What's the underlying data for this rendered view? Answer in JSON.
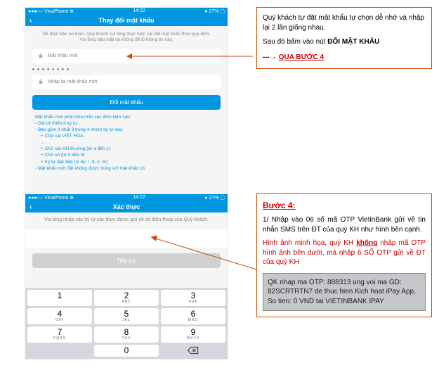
{
  "phone1": {
    "status": {
      "carrier": "●●●○○ VinaPhone ⊕",
      "time": "14:22",
      "battery": "● 27% ▢"
    },
    "title": "Thay đổi mật khẩu",
    "subtitle": "Để đảm bảo an toàn, Quý khách vui lòng thực hiện cài đặt mật khẩu theo quy định. Vui lòng bảo mật và không để lộ thông tin này.",
    "input1_label": "Mật khẩu mới",
    "input1_dots": "• • • • • • • •",
    "input2_label": "Nhập lại mật khẩu mới",
    "button": "Đổi mật khẩu",
    "rules": {
      "header": "Mật khẩu mới phải thỏa mãn các điều kiện sau:",
      "r1": "- Dài tối thiểu 8 ký tự",
      "r2": "- Bao gồm ít nhất 3 trong 4 nhóm ký tự sau:",
      "r2a": "+ Chữ cái VIẾT HOA",
      "r2b": "  ...",
      "r2c": "+ Chữ cái viết thường (từ a đến z)",
      "r2d": "+ Chữ số (từ 0 đến 9)",
      "r2e": "+ Ký tự đặc biệt (ví dụ: !, $, #, %)",
      "r3": "- Mật khẩu mới đặt không được trùng với mật khẩu cũ"
    }
  },
  "phone2": {
    "status": {
      "carrier": "●●●○○ VinaPhone ⊕",
      "time": "14:22",
      "battery": "● 27% ▢"
    },
    "title": "Xác thực",
    "subtitle": "Vui lòng nhập các ký tự xác thực được gửi về số điện thoại của Quý khách.",
    "button": "Tiếp tục",
    "keys": [
      {
        "n": "1",
        "l": ""
      },
      {
        "n": "2",
        "l": "ABC"
      },
      {
        "n": "3",
        "l": "DEF"
      },
      {
        "n": "4",
        "l": "GHI"
      },
      {
        "n": "5",
        "l": "JKL"
      },
      {
        "n": "6",
        "l": "MNO"
      },
      {
        "n": "7",
        "l": "PQRS"
      },
      {
        "n": "8",
        "l": "TUV"
      },
      {
        "n": "9",
        "l": "WXYZ"
      },
      {
        "n": "",
        "l": ""
      },
      {
        "n": "0",
        "l": ""
      },
      {
        "n": "⌫",
        "l": ""
      }
    ]
  },
  "box1": {
    "line1a": "Quý khách tự đặt mật khẩu tự chọn dễ nhớ và nhập lại 2 lần giống nhau.",
    "line2a": "Sau đó bấm vào nút ",
    "line2b": "ĐỔI MẬT KHẨU",
    "arrow": "---→ ",
    "arrowlink": "QUA BƯỚC 4"
  },
  "box2": {
    "title": "Bước 4:",
    "p1": "1/ Nhập vào 06 số mã OTP VietinBank gửi về tin nhắn SMS trên ĐT của quý KH như hình bên cạnh.",
    "p2a": "Hình ảnh minh họa, quý KH ",
    "p2b": "không",
    "p2c": " nhập mã OTP hình ảnh bên dưới, mà nhập 6 SỐ OTP gửi về ĐT của quý KH",
    "sms": "QK nhap ma OTP: 888313 ung voi ma GD: 82SCRTRTN7 de thuc hien Kich hoat iPay App, So tien: 0 VND tai VIETINBANK IPAY"
  }
}
